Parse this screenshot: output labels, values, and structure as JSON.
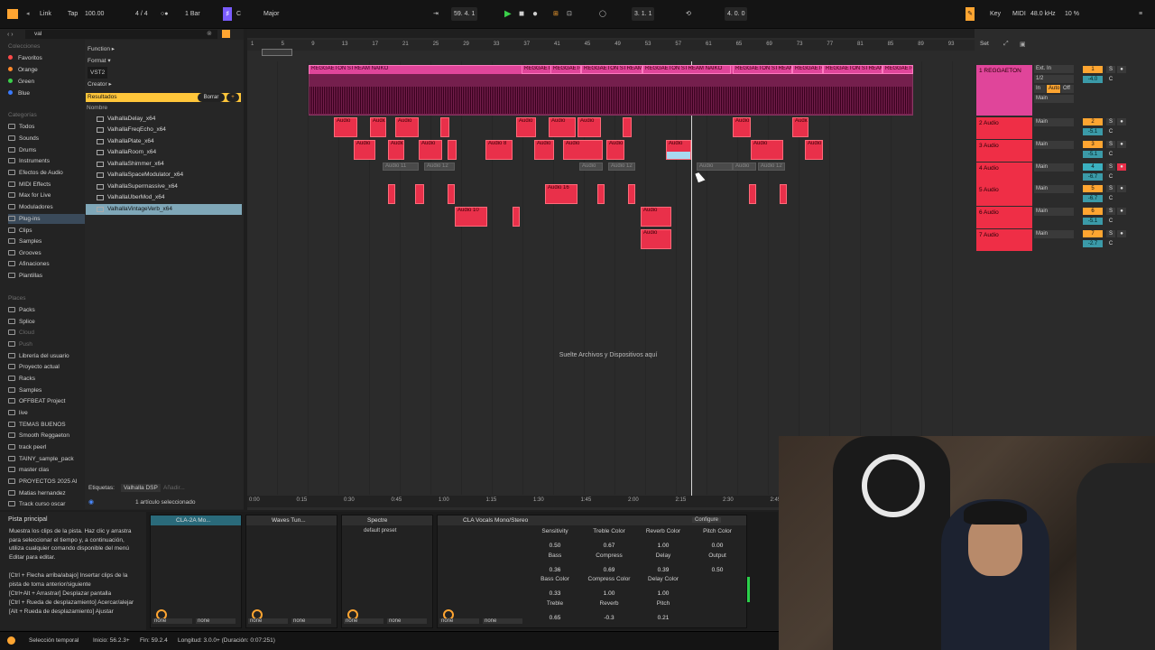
{
  "topbar": {
    "link": "Link",
    "tap": "Tap",
    "tempo": "100.00",
    "sig": "4 / 4",
    "quant": "1 Bar",
    "key_root": "C",
    "scale": "Major",
    "position": "59.   4.   1",
    "loop_start": "3.   1.   1",
    "loop_len": "4.   0.   0",
    "key_btn": "Key",
    "midi": "MIDI",
    "sample_rate": "48.0 kHz",
    "cpu": "10 %"
  },
  "browser": {
    "search": "val",
    "collections_title": "Colecciones",
    "collections": [
      {
        "label": "Favoritos",
        "color": "#ff4a4a"
      },
      {
        "label": "Orange",
        "color": "#ff8a2a"
      },
      {
        "label": "Green",
        "color": "#3ad04a"
      },
      {
        "label": "Blue",
        "color": "#3a7aff"
      }
    ],
    "categories_title": "Categorías",
    "categories": [
      "Todos",
      "Sounds",
      "Drums",
      "Instruments",
      "Efectos de Audio",
      "MIDI Effects",
      "Max for Live",
      "Moduladores",
      "Plug-ins",
      "Clips",
      "Samples",
      "Grooves",
      "Afinaciones",
      "Plantillas"
    ],
    "places_title": "Places",
    "places": [
      "Packs",
      "Splice",
      "Cloud",
      "Push",
      "Librería del usuario",
      "Proyecto actual",
      "Racks",
      "Samples",
      "OFFBEAT Project",
      "live",
      "TEMAS BUENOS",
      "Smooth Reggaeton",
      "track peerl",
      "TAINY_sample_pack",
      "master clas",
      "PROYECTOS 2025 AI",
      "Matias hernandez",
      "Track curso oscar"
    ],
    "filters": [
      "Function ▸",
      "Format ▾",
      "VST2",
      "Creator ▸"
    ],
    "results_label": "Resultados",
    "clear_label": "Borrar",
    "col_name": "Nombre",
    "files": [
      "ValhallaDelay_x64",
      "ValhallaFreqEcho_x64",
      "ValhallaPlate_x64",
      "ValhallaRoom_x64",
      "ValhallaShimmer_x64",
      "ValhallaSpaceModulator_x64",
      "ValhallaSupermassive_x64",
      "ValhallaUberMod_x64",
      "ValhallaVintageVerb_x64"
    ],
    "tags_label": "Etiquetas:",
    "tag_value": "Valhalla DSP",
    "tag_add": "Añadir...",
    "selection_count": "1 artículo seleccionado"
  },
  "ruler": [
    "1",
    "5",
    "9",
    "13",
    "17",
    "21",
    "25",
    "29",
    "33",
    "37",
    "41",
    "45",
    "49",
    "53",
    "57",
    "61",
    "65",
    "69",
    "73",
    "77",
    "81",
    "85",
    "89",
    "93"
  ],
  "time_ruler": [
    "0:00",
    "0:15",
    "0:30",
    "0:45",
    "1:00",
    "1:15",
    "1:30",
    "1:45",
    "2:00",
    "2:15",
    "2:30",
    "2:45"
  ],
  "drop_hint": "Suelte Archivos y Dispositivos aquí",
  "tracks": [
    {
      "name": "1 REGGAETON",
      "input": "Ext. In",
      "chan": "1/2",
      "monitor": [
        "In",
        "Auto",
        "Off"
      ],
      "out": "Main",
      "num": "1",
      "vol": "-4.0",
      "pan": "C"
    },
    {
      "name": "2 Audio",
      "out": "Main",
      "num": "2",
      "vol": "-5.1",
      "pan": "C"
    },
    {
      "name": "3 Audio",
      "out": "Main",
      "num": "3",
      "vol": "-5.1",
      "pan": "C"
    },
    {
      "name": "4 Audio",
      "out": "Main",
      "num": "4",
      "vol": "-6.7",
      "pan": "C"
    },
    {
      "name": "5 Audio",
      "out": "Main",
      "num": "5",
      "vol": "-6.7",
      "pan": "C"
    },
    {
      "name": "6 Audio",
      "out": "Main",
      "num": "6",
      "vol": "-5.1",
      "pan": "C"
    },
    {
      "name": "7 Audio",
      "out": "Main",
      "num": "7",
      "vol": "-2.7",
      "pan": "C"
    }
  ],
  "set_label": "Set",
  "clips": {
    "reggaeton": "REGGAETON STREAM NAIKO",
    "short": "REGGAETO",
    "audio": "Audio",
    "audio8": "Audio 8",
    "audio10": "Audio 10",
    "audio16": "Audio 16",
    "audio11": "Audio 11",
    "audio12": "Audio 12"
  },
  "info": {
    "title": "Pista principal",
    "text": "Muestra los clips de la pista. Haz clic y arrastra para seleccionar el tiempo y, a continuación, utiliza cualquier comando disponible del menú Editar para editar.",
    "shortcuts": "[Ctrl + Flecha arriba/abajo] Insertar clips de la pista de toma anterior/siguiente\n[Ctrl+Alt + Arrastrar] Desplazar pantalla\n[Ctrl + Rueda de desplazamiento] Acercar/alejar\n[Alt + Rueda de desplazamiento] Ajustar"
  },
  "devices": [
    {
      "name": "CLA-2A Mo..."
    },
    {
      "name": "Waves Tun..."
    },
    {
      "name": "Spectre",
      "preset": "default preset"
    },
    {
      "name": "CLA Vocals Mono/Stereo",
      "config": "Configure"
    }
  ],
  "none": "none",
  "params": [
    {
      "n": "Sensitivity",
      "v": "0.50"
    },
    {
      "n": "Treble Color",
      "v": "0.67"
    },
    {
      "n": "Reverb Color",
      "v": "1.00"
    },
    {
      "n": "Pitch Color",
      "v": "0.00"
    },
    {
      "n": "Bass",
      "v": "0.36"
    },
    {
      "n": "Compress",
      "v": "0.69"
    },
    {
      "n": "Delay",
      "v": "0.39"
    },
    {
      "n": "Output",
      "v": "0.50"
    },
    {
      "n": "Bass Color",
      "v": "0.33"
    },
    {
      "n": "Compress Color",
      "v": "1.00"
    },
    {
      "n": "Delay Color",
      "v": "1.00"
    },
    {
      "n": "Treble",
      "v": "0.65"
    },
    {
      "n": "Reverb",
      "v": "-0.3"
    },
    {
      "n": "Pitch",
      "v": "0.21"
    }
  ],
  "status": {
    "mode": "Selección temporal",
    "start": "Inicio: 56.2.3+",
    "end": "Fin: 59.2.4",
    "length": "Longitud: 3.0.0+ (Duración: 0:07:251)"
  }
}
